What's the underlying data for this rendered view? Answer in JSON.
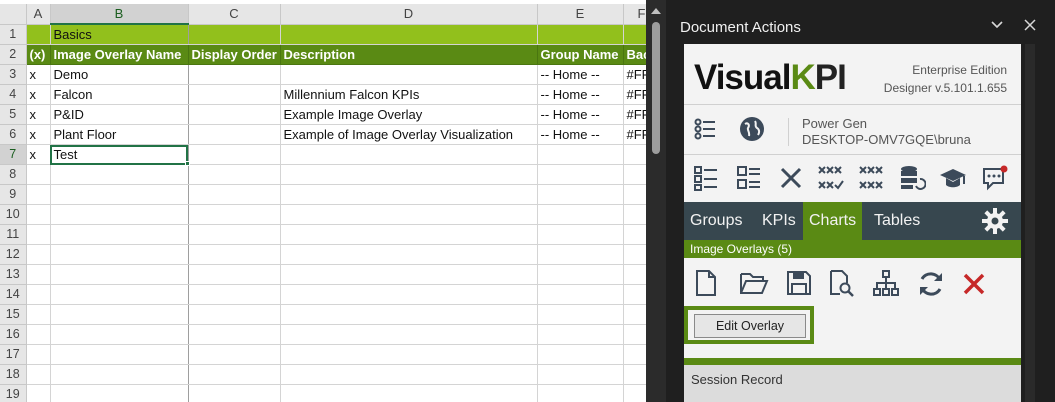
{
  "sheet": {
    "columns": [
      "A",
      "B",
      "C",
      "D",
      "E",
      "F"
    ],
    "row_numbers": [
      "1",
      "2",
      "3",
      "4",
      "5",
      "6",
      "7",
      "8",
      "9",
      "10",
      "11",
      "12",
      "13",
      "14",
      "15",
      "16",
      "17",
      "18",
      "19"
    ],
    "basics_label": "Basics",
    "headers": [
      "(x)",
      "Image Overlay Name",
      "Display Order",
      "Description",
      "Group Name",
      "Bac"
    ],
    "rows": [
      {
        "x": "x",
        "name": "Demo",
        "order": "",
        "description": "",
        "group": "-- Home --",
        "bg": "#FF"
      },
      {
        "x": "x",
        "name": "Falcon",
        "order": "",
        "description": "Millennium Falcon KPIs",
        "group": "-- Home --",
        "bg": "#FF"
      },
      {
        "x": "x",
        "name": "P&ID",
        "order": "",
        "description": "Example Image Overlay",
        "group": "-- Home --",
        "bg": "#FF"
      },
      {
        "x": "x",
        "name": "Plant Floor",
        "order": "",
        "description": "Example of Image Overlay Visualization",
        "group": "-- Home --",
        "bg": "#FF"
      },
      {
        "x": "x",
        "name": "Test",
        "order": "",
        "description": "",
        "group": "",
        "bg": ""
      }
    ],
    "selected_cell": "B7"
  },
  "pane": {
    "title": "Document Actions",
    "brand": {
      "visual": "Visual",
      "kpi_k": "K",
      "kpi_rest": "PI"
    },
    "edition": "Enterprise Edition",
    "version": "Designer v.5.101.1.655",
    "site": "Power Gen",
    "machine": "DESKTOP-OMV7GQE\\bruna",
    "tabs": [
      "Groups",
      "KPIs",
      "Charts",
      "Tables"
    ],
    "active_tab": "Charts",
    "section_title": "Image Overlays (5)",
    "edit_button": "Edit Overlay",
    "session_title": "Session Record",
    "icons_row1": [
      "list-icon",
      "globe-icon"
    ],
    "icons_row2": [
      "checklist-icon",
      "list-box-icon",
      "close-x-icon",
      "multi-check-icon",
      "multi-x-icon",
      "database-refresh-icon",
      "graduation-cap-icon",
      "chat-notification-icon"
    ],
    "icons_row3": [
      "new-file-icon",
      "open-folder-icon",
      "save-icon",
      "search-document-icon",
      "hierarchy-icon",
      "refresh-icon",
      "delete-icon"
    ],
    "colors": {
      "green": "#5a8a14",
      "light_green": "#92c01c",
      "tab_bar": "#37474f",
      "red": "#c62828"
    }
  }
}
